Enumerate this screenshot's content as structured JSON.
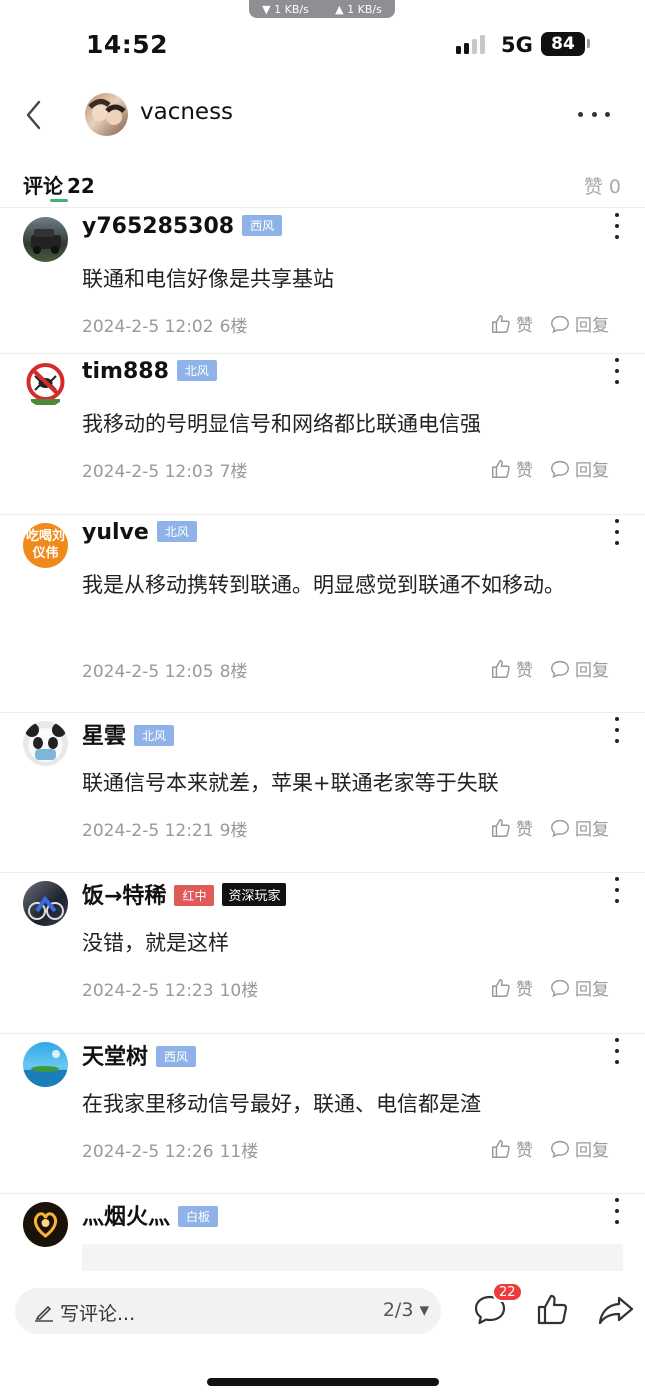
{
  "status_bar": {
    "net_down": "▼ 1 KB/s",
    "net_up": "▲ 1 KB/s",
    "time": "14:52",
    "network": "5G",
    "battery": "84"
  },
  "header": {
    "username": "vacness"
  },
  "tabs": {
    "comments_label": "评论",
    "comments_count": "22",
    "likes_label": "赞",
    "likes_count": "0"
  },
  "comments": [
    {
      "user": "y765285308",
      "tag": "西风",
      "badge": "",
      "text": "联通和电信好像是共享基站",
      "date": "2024-2-5 12:02",
      "floor": "6楼"
    },
    {
      "user": "tim888",
      "tag": "北风",
      "badge": "",
      "text": "我移动的号明显信号和网络都比联通电信强",
      "date": "2024-2-5 12:03",
      "floor": "7楼"
    },
    {
      "user": "yulve",
      "tag": "北风",
      "badge": "",
      "text": "我是从移动携转到联通。明显感觉到联通不如移动。",
      "date": "2024-2-5 12:05",
      "floor": "8楼",
      "avatar_text": "吃喝刘仪伟"
    },
    {
      "user": "星雲",
      "tag": "北风",
      "badge": "",
      "text": "联通信号本来就差，苹果+联通老家等于失联",
      "date": "2024-2-5 12:21",
      "floor": "9楼"
    },
    {
      "user": "饭→特稀",
      "tag": "红中",
      "badge": "资深玩家",
      "text": "没错，就是这样",
      "date": "2024-2-5 12:23",
      "floor": "10楼"
    },
    {
      "user": "天堂树",
      "tag": "西风",
      "badge": "",
      "text": "在我家里移动信号最好，联通、电信都是渣",
      "date": "2024-2-5 12:26",
      "floor": "11楼"
    },
    {
      "user": "灬烟火灬",
      "tag": "白板",
      "badge": "",
      "text": "",
      "date": "",
      "floor": ""
    }
  ],
  "actions": {
    "like": "赞",
    "reply": "回复"
  },
  "bottom_bar": {
    "placeholder": "写评论...",
    "page": "2/3",
    "comment_badge": "22"
  },
  "colors": {
    "accent_green": "#3cb371",
    "tag_blue": "#8fb3e8",
    "tag_red": "#e05a5a",
    "badge_red": "#ee3b3b",
    "meta_gray": "#999999"
  },
  "icons": [
    "back-icon",
    "more-icon",
    "like-icon",
    "reply-icon",
    "pen-icon",
    "comment-icon",
    "thumb-up-icon",
    "share-icon"
  ]
}
